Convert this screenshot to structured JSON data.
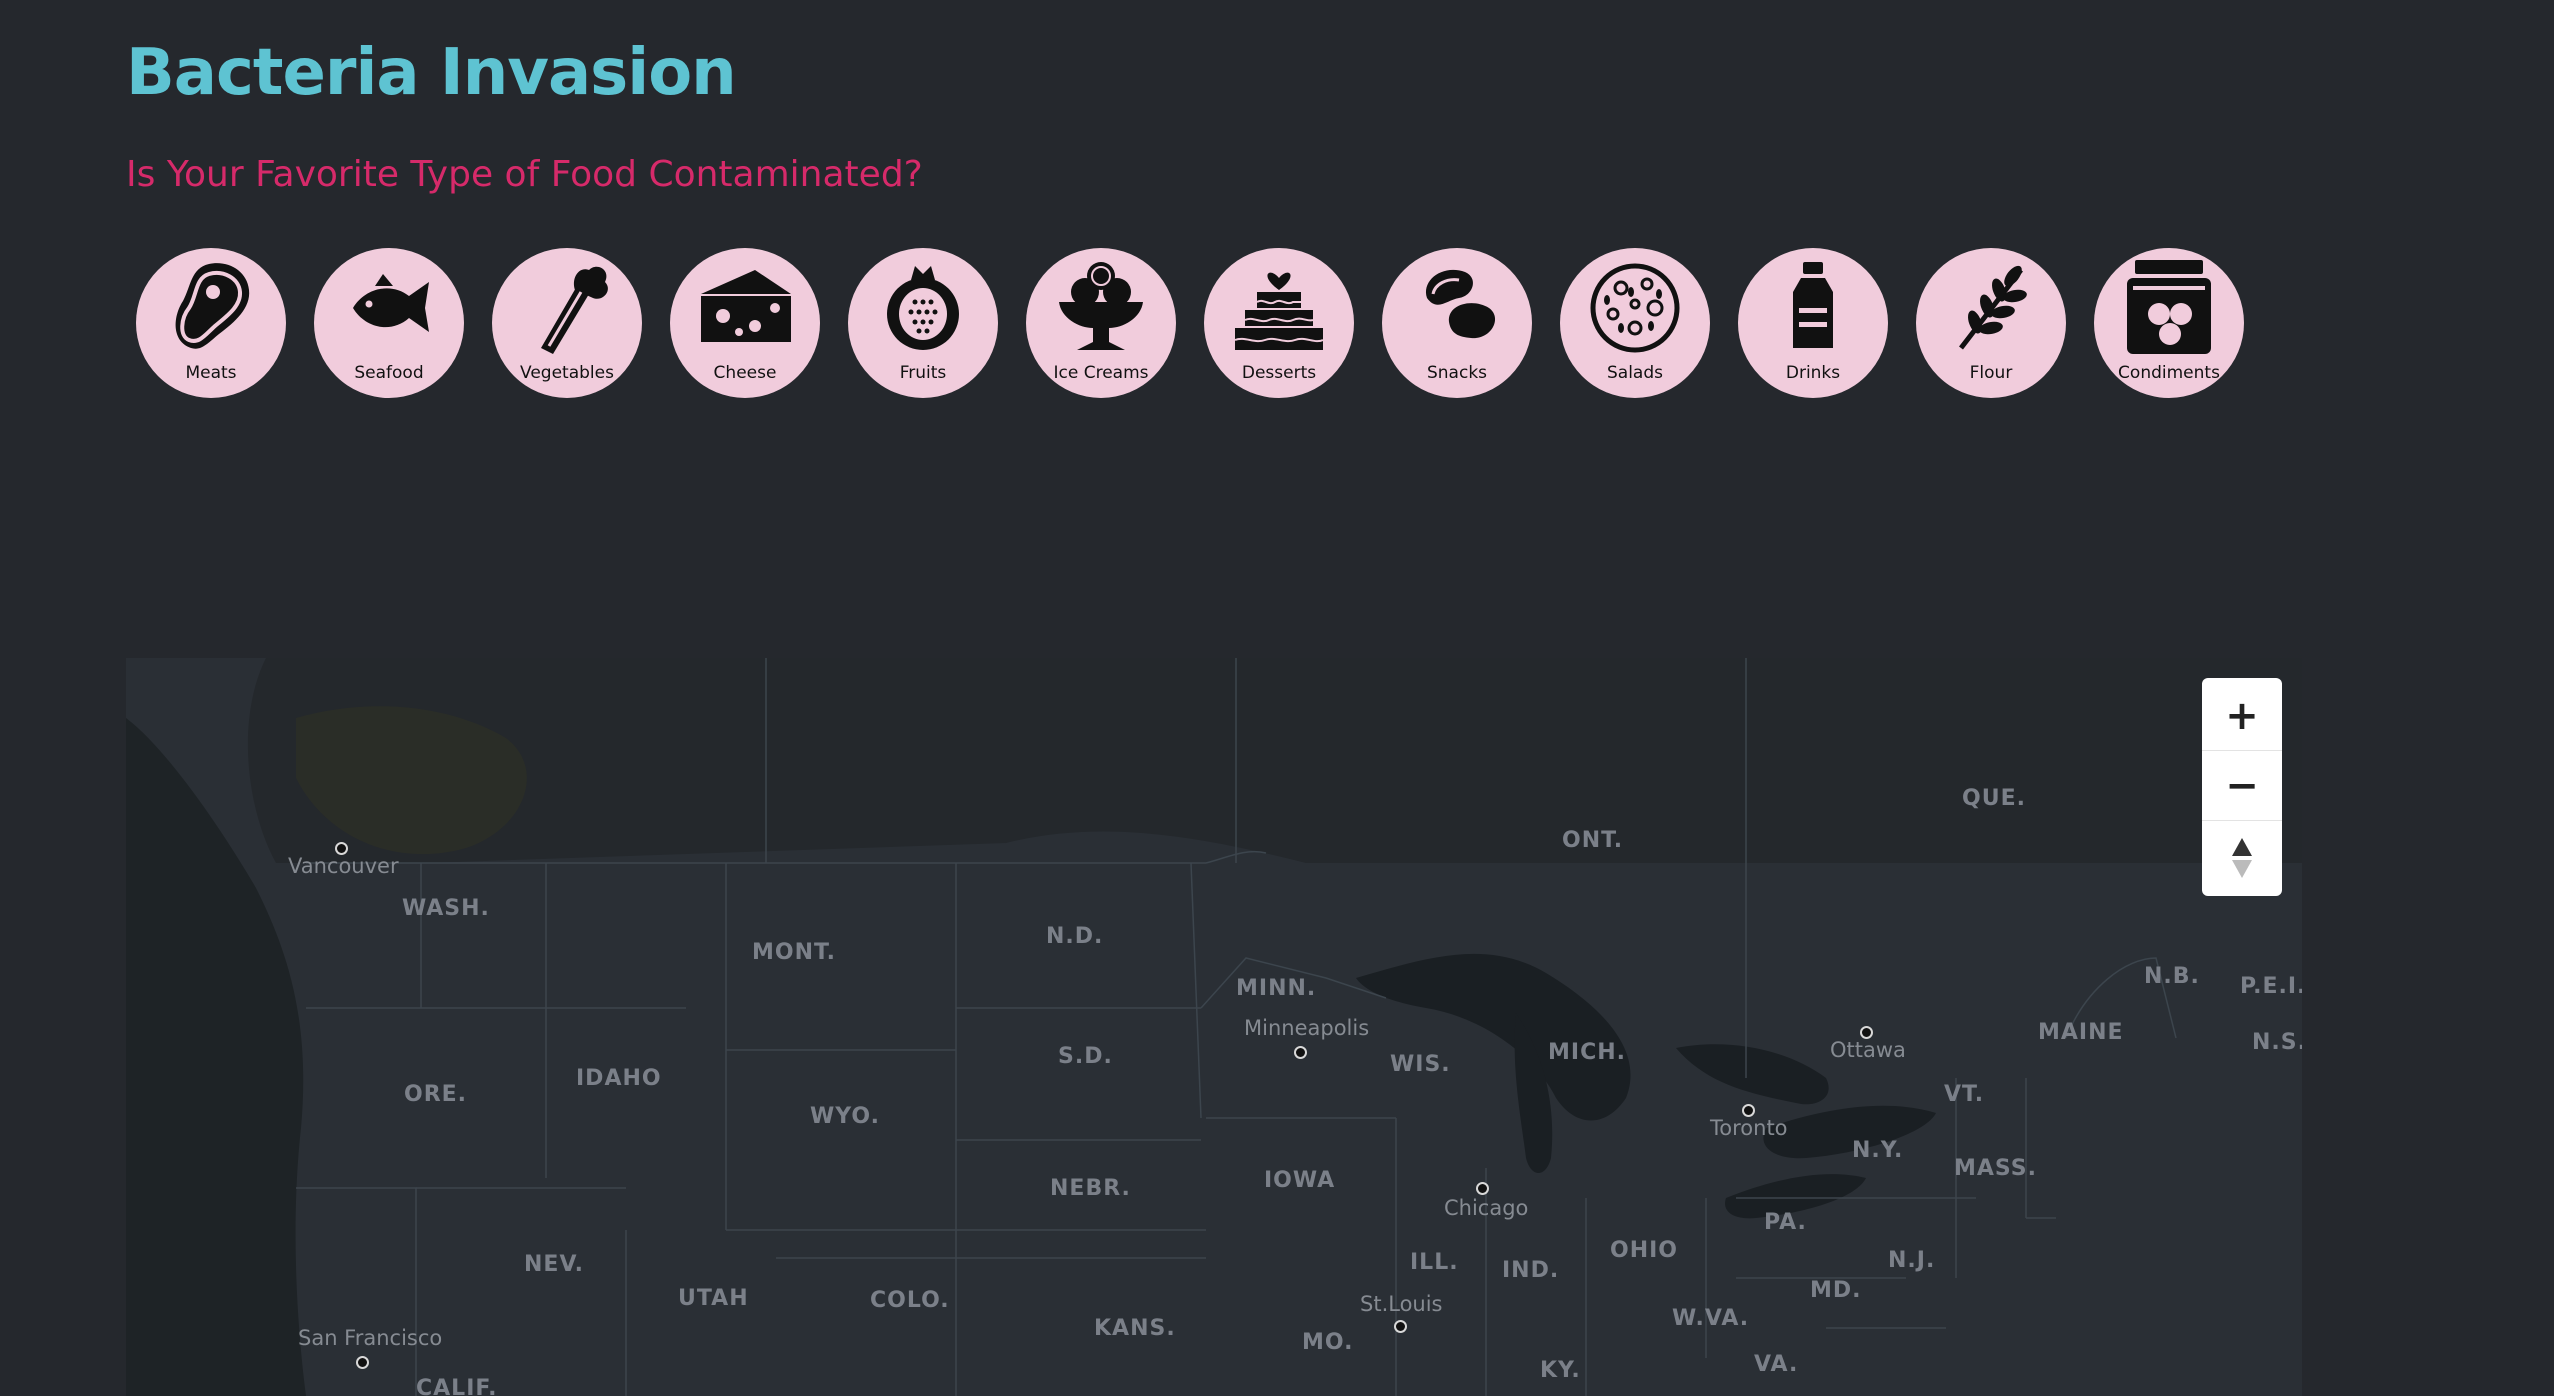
{
  "header": {
    "title": "Bacteria Invasion",
    "subtitle": "Is Your Favorite Type of Food Contaminated?"
  },
  "categories": [
    {
      "label": "Meats",
      "icon": "steak-icon"
    },
    {
      "label": "Seafood",
      "icon": "fish-icon"
    },
    {
      "label": "Vegetables",
      "icon": "celery-icon"
    },
    {
      "label": "Cheese",
      "icon": "cheese-icon"
    },
    {
      "label": "Fruits",
      "icon": "pomegranate-icon"
    },
    {
      "label": "Ice Creams",
      "icon": "ice-cream-sundae-icon"
    },
    {
      "label": "Desserts",
      "icon": "cake-icon"
    },
    {
      "label": "Snacks",
      "icon": "beans-icon"
    },
    {
      "label": "Salads",
      "icon": "salad-bowl-icon"
    },
    {
      "label": "Drinks",
      "icon": "bottle-icon"
    },
    {
      "label": "Flour",
      "icon": "wheat-icon"
    },
    {
      "label": "Condiments",
      "icon": "jar-icon"
    }
  ],
  "map": {
    "states": {
      "wash": "WASH.",
      "mont": "MONT.",
      "nd": "N.D.",
      "minn": "MINN.",
      "ore": "ORE.",
      "idaho": "IDAHO",
      "sd": "S.D.",
      "wyo": "WYO.",
      "wis": "WIS.",
      "mich": "MICH.",
      "iowa": "IOWA",
      "nebr": "NEBR.",
      "nev": "NEV.",
      "utah": "UTAH",
      "colo": "COLO.",
      "kans": "KANS.",
      "mo": "MO.",
      "ill": "ILL.",
      "ind": "IND.",
      "ohio": "OHIO",
      "ky": "KY.",
      "wva": "W.VA.",
      "va": "VA.",
      "pa": "PA.",
      "md": "MD.",
      "nj": "N.J.",
      "ny": "N.Y.",
      "mass": "MASS.",
      "vt": "VT.",
      "maine": "MAINE",
      "calif": "CALIF.",
      "ont": "ONT.",
      "que": "QUE.",
      "nb": "N.B.",
      "pei": "P.E.I.",
      "ns": "N.S."
    },
    "cities": {
      "vancouver": "Vancouver",
      "minneapolis": "Minneapolis",
      "chicago": "Chicago",
      "toronto": "Toronto",
      "ottawa": "Ottawa",
      "st_louis": "St.Louis",
      "san_francisco": "San Francisco"
    },
    "controls": {
      "zoom_in": "+",
      "zoom_out": "−"
    }
  }
}
